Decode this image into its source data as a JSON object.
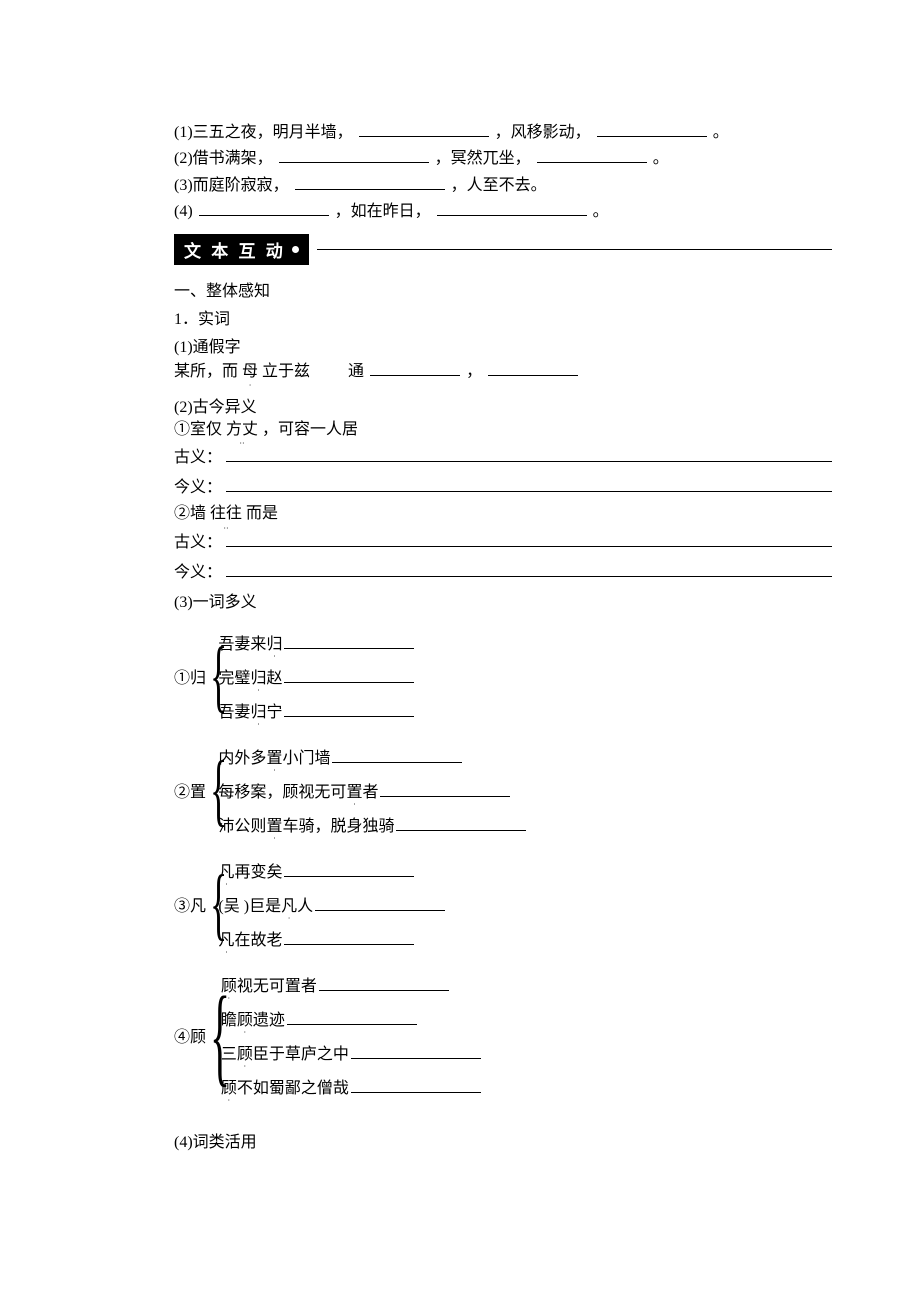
{
  "fill": {
    "q1_pre": "(1)三五之夜，明月半墙，",
    "q1_mid": "，风移影动，",
    "q1_end": "。",
    "q2_pre": "(2)借书满架，",
    "q2_mid": "，冥然兀坐，",
    "q2_end": "。",
    "q3_pre": "(3)而庭阶寂寂，",
    "q3_mid": "，人至不去。",
    "q4_pre": "(4)",
    "q4_mid": "，如在昨日，",
    "q4_end": "。"
  },
  "section_bar": "文 本 互 动",
  "headings": {
    "h1": "一、整体感知",
    "h2": "1．实词",
    "sub1": "(1)通假字",
    "sub2": "(2)古今异义",
    "sub3": "(3)一词多义",
    "sub4": "(4)词类活用"
  },
  "tongjia": {
    "pre": "某所，而",
    "emph": "母",
    "post1": "立于兹",
    "tong": "通",
    "comma": "，"
  },
  "gujin": {
    "g1_pre": "①室仅",
    "g1_emph": "方丈",
    "g1_post": "，可容一人居",
    "g2_pre": "②墙",
    "g2_emph": "往往",
    "g2_post": "而是",
    "guyi": "古义：",
    "jinyi": "今义："
  },
  "gui": {
    "label": "①归",
    "r1a": "吾妻来",
    "r1b": "归",
    "r2a": "完璧",
    "r2b": "归",
    "r2c": "赵",
    "r3a": "吾妻",
    "r3b": "归",
    "r3c": "宁"
  },
  "zhi": {
    "label": "②置",
    "r1a": "内外多",
    "r1b": "置",
    "r1c": "小门墙",
    "r2a": "每移案，顾视无可",
    "r2b": "置",
    "r2c": "者",
    "r3a": "沛公则",
    "r3b": "置",
    "r3c": "车骑，脱身独骑"
  },
  "fan": {
    "label": "③凡",
    "r1a": "凡",
    "r1b": "再变矣",
    "r2a": "(吴 )巨是",
    "r2b": "凡",
    "r2c": "人",
    "r3a": "凡",
    "r3b": "在故老"
  },
  "gu": {
    "label": "④顾",
    "r1a": "顾",
    "r1b": "视无可置者",
    "r2a": "瞻",
    "r2b": "顾",
    "r2c": "遗迹",
    "r3a": "三",
    "r3b": "顾",
    "r3c": "臣于草庐之中",
    "r4a": "顾",
    "r4b": "不如蜀鄙之僧哉"
  }
}
